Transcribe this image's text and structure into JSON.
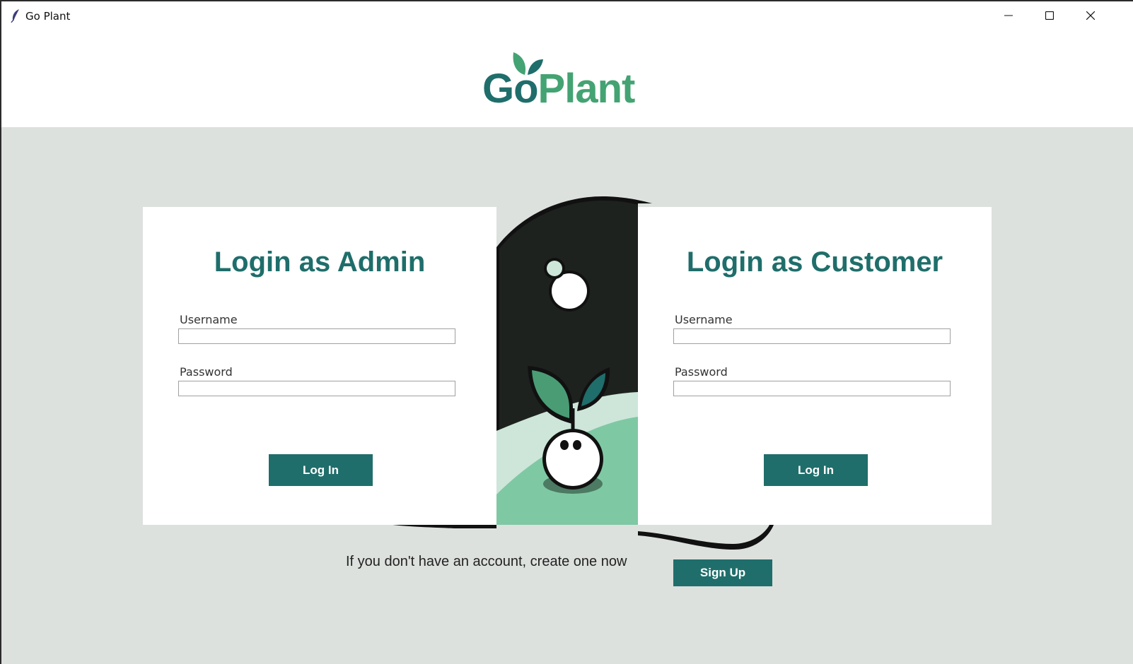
{
  "window": {
    "title": "Go Plant",
    "app_icon": "feather-icon",
    "controls": [
      "minimize-icon",
      "maximize-icon",
      "close-icon"
    ]
  },
  "logo": {
    "part1": "Go",
    "part2": "Plant"
  },
  "admin": {
    "title": "Login as Admin",
    "username_label": "Username",
    "password_label": "Password",
    "username_value": "",
    "password_value": "",
    "login_label": "Log In"
  },
  "customer": {
    "title": "Login as Customer",
    "username_label": "Username",
    "password_label": "Password",
    "username_value": "",
    "password_value": "",
    "login_label": "Log In"
  },
  "signup": {
    "prompt": "If you don't have an account, create one now",
    "button_label": "Sign Up"
  },
  "colors": {
    "accent": "#1f6e6b",
    "brand_green": "#44a373",
    "background": "#dde1de",
    "illustration_dark": "#1e221f",
    "illustration_light_green": "#7fc8a4"
  }
}
